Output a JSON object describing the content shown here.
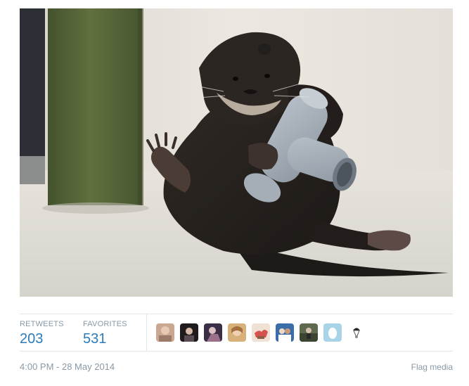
{
  "stats": {
    "retweets_label": "RETWEETS",
    "retweets_count": "203",
    "favorites_label": "FAVORITES",
    "favorites_count": "531"
  },
  "favoriters": [
    "avatar-1",
    "avatar-2",
    "avatar-3",
    "avatar-4",
    "avatar-5",
    "avatar-6",
    "avatar-7",
    "avatar-8",
    "avatar-9"
  ],
  "footer": {
    "timestamp": "4:00 PM - 28 May 2014",
    "flag_label": "Flag media"
  },
  "colors": {
    "link_blue": "#2b7bb9",
    "muted_gray": "#8899a6",
    "border": "#e1e8ed"
  },
  "icons": {
    "egg": "default-egg-avatar-icon"
  }
}
